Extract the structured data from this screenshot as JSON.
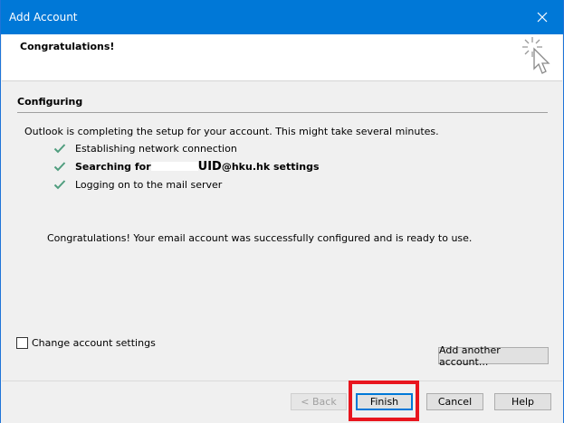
{
  "window": {
    "title": "Add Account",
    "close_icon": "close-icon"
  },
  "header": {
    "heading": "Congratulations!",
    "graphic_icon": "cursor-sparkle-icon"
  },
  "configuring": {
    "title": "Configuring",
    "intro": "Outlook is completing the setup for your account. This might take several minutes.",
    "steps": [
      {
        "label": "Establishing network connection",
        "status_icon": "check-icon"
      },
      {
        "label_pre": "Searching for",
        "uid": "UID",
        "label_post": "@hku.hk settings",
        "status_icon": "check-icon"
      },
      {
        "label": "Logging on to the mail server",
        "status_icon": "check-icon"
      }
    ],
    "success_message": "Congratulations! Your email account was successfully configured and is ready to use."
  },
  "options": {
    "change_settings_label": "Change account settings",
    "change_settings_checked": false,
    "add_another_label": "Add another account..."
  },
  "footer": {
    "back_label": "< Back",
    "finish_label": "Finish",
    "cancel_label": "Cancel",
    "help_label": "Help"
  },
  "colors": {
    "titlebar": "#0078d7",
    "check": "#4f9d7e",
    "highlight": "#e8151e"
  }
}
